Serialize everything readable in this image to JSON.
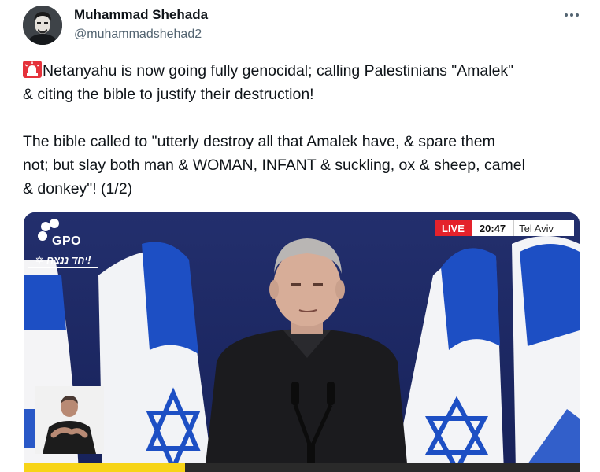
{
  "author": {
    "display_name": "Muhammad Shehada",
    "handle": "@muhammadshehad2",
    "avatar": "profile-photo"
  },
  "more_icon": "more-horizontal-icon",
  "tweet": {
    "siren_icon": "rotating-light-emoji",
    "line1": "Netanyahu is now going fully genocidal; calling Palestinians \"Amalek\"",
    "line2": "& citing the bible to justify their destruction!",
    "line3": "The bible called to \"utterly destroy all that Amalek have, & spare them",
    "line4": "not; but slay both man & WOMAN, INFANT & suckling, ox & sheep, camel",
    "line5": "& donkey\"! (1/2)"
  },
  "media": {
    "type": "video",
    "broadcaster_logo": "GPO",
    "hebrew_tag": "✡ יחד ננצח!",
    "live_label": "LIVE",
    "time": "20:47",
    "city": "Tel Aviv",
    "progress_fraction": 0.29,
    "colors": {
      "background": "#1d2c6a",
      "flag_blue": "#1d4fc4",
      "live_red": "#e4222b",
      "progress": "#f7d417"
    }
  }
}
